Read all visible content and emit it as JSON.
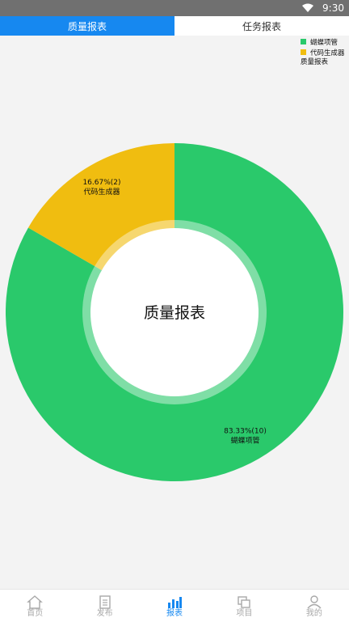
{
  "status_bar": {
    "time": "9:30"
  },
  "tabs": [
    {
      "label": "质量报表",
      "active": true
    },
    {
      "label": "任务报表",
      "active": false
    }
  ],
  "legend": {
    "items": [
      {
        "label": "蝴蝶项管",
        "color": "#2ac96b"
      },
      {
        "label": "代码生成器",
        "color": "#f0bd10"
      }
    ],
    "title": "质量报表"
  },
  "chart_data": {
    "type": "pie",
    "title": "",
    "center_label": "质量报表",
    "slices": [
      {
        "label": "蝴蝶项管",
        "value": 10,
        "percent_label": "83.33%(10)",
        "color": "#2ac96b"
      },
      {
        "label": "代码生成器",
        "value": 2,
        "percent_label": "16.67%(2)",
        "color": "#f0bd10"
      }
    ],
    "legend_position": "top-right"
  },
  "bottom_nav": [
    {
      "label": "首页",
      "icon": "home-icon",
      "active": false
    },
    {
      "label": "发布",
      "icon": "publish-icon",
      "active": false
    },
    {
      "label": "报表",
      "icon": "report-icon",
      "active": true
    },
    {
      "label": "项目",
      "icon": "project-icon",
      "active": false
    },
    {
      "label": "我的",
      "icon": "profile-icon",
      "active": false
    }
  ]
}
